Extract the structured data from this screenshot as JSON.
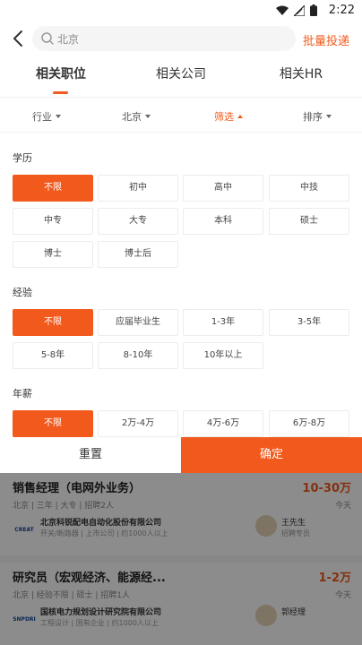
{
  "status_bar": {
    "time": "2:22"
  },
  "search": {
    "query": "北京",
    "batch_apply": "批量投递"
  },
  "tabs": [
    {
      "label": "相关职位"
    },
    {
      "label": "相关公司"
    },
    {
      "label": "相关HR"
    }
  ],
  "filters": {
    "industry": "行业",
    "city": "北京",
    "filter": "筛选",
    "sort": "排序"
  },
  "education": {
    "title": "学历",
    "options": [
      "不限",
      "初中",
      "高中",
      "中技",
      "中专",
      "大专",
      "本科",
      "硕士",
      "博士",
      "博士后"
    ]
  },
  "experience": {
    "title": "经验",
    "options": [
      "不限",
      "应届毕业生",
      "1-3年",
      "3-5年",
      "5-8年",
      "8-10年",
      "10年以上"
    ]
  },
  "salary": {
    "title": "年薪",
    "options": [
      "不限",
      "2万-4万",
      "4万-6万",
      "6万-8万"
    ]
  },
  "actions": {
    "reset": "重置",
    "confirm": "确定"
  },
  "jobs": [
    {
      "title": "销售经理（电网外业务）",
      "salary": "10-30万",
      "meta": "北京 | 三年 | 大专 | 招聘2人",
      "date": "今天",
      "company": "北京科锐配电自动化股份有限公司",
      "company_sub": "开关/断路器 | 上市公司 | 约1000人以上",
      "company_logo_text": "CREAT",
      "hr_name": "王先生",
      "hr_role": "招聘专员"
    },
    {
      "title": "研究员（宏观经济、能源经...",
      "salary": "1-2万",
      "meta": "北京 | 经验不限 | 硕士 | 招聘1人",
      "date": "今天",
      "company": "国核电力规划设计研究院有限公司",
      "company_sub": "工程设计 | 国有企业 | 约1000人以上",
      "company_logo_text": "SNPDRI",
      "hr_name": "郭经理",
      "hr_role": ""
    }
  ],
  "colors": {
    "accent": "#f25a1d"
  }
}
